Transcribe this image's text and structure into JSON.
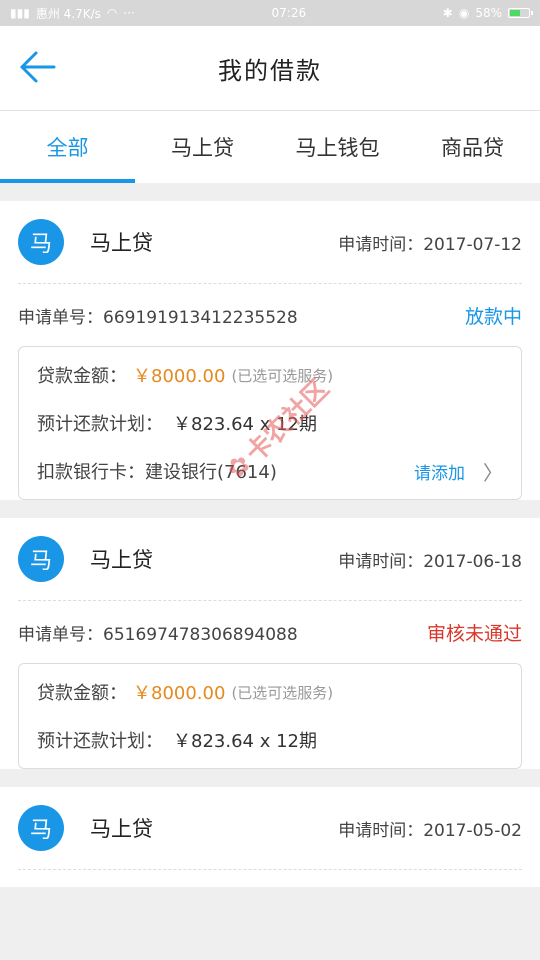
{
  "status_bar": {
    "carrier": "惠州 4.7K/s",
    "time": "07:26",
    "battery": "58%",
    "battery_level": 0.58
  },
  "nav": {
    "title": "我的借款"
  },
  "tabs": [
    {
      "label": "全部",
      "active": true
    },
    {
      "label": "马上贷",
      "active": false
    },
    {
      "label": "马上钱包",
      "active": false
    },
    {
      "label": "商品贷",
      "active": false
    }
  ],
  "loans": [
    {
      "logo": "马",
      "product": "马上贷",
      "apply_time": "申请时间：2017-07-12",
      "order_no": "申请单号：669191913412235528",
      "status": "放款中",
      "amount_label": "贷款金额：",
      "amount": "￥8000.00",
      "amount_note": "(已选可选服务)",
      "plan_label": "预计还款计划：",
      "plan_value": "￥823.64 x 12期",
      "bank_label": "扣款银行卡：建设银行(7614)",
      "bind_label": "请添加"
    },
    {
      "logo": "马",
      "product": "马上贷",
      "apply_time": "申请时间：2017-06-18",
      "order_no": "申请单号：651697478306894088",
      "status": "审核未通过",
      "amount_label": "贷款金额：",
      "amount": "￥8000.00",
      "amount_note": "(已选可选服务)",
      "plan_label": "预计还款计划：",
      "plan_value": "￥823.64 x 12期"
    },
    {
      "logo": "马",
      "product": "马上贷",
      "apply_time": "申请时间：2017-05-02"
    }
  ],
  "watermark": "卡农社区",
  "colors": {
    "accent": "#1a96e6",
    "amount": "#e58a1f",
    "rejected": "#d9372b"
  }
}
